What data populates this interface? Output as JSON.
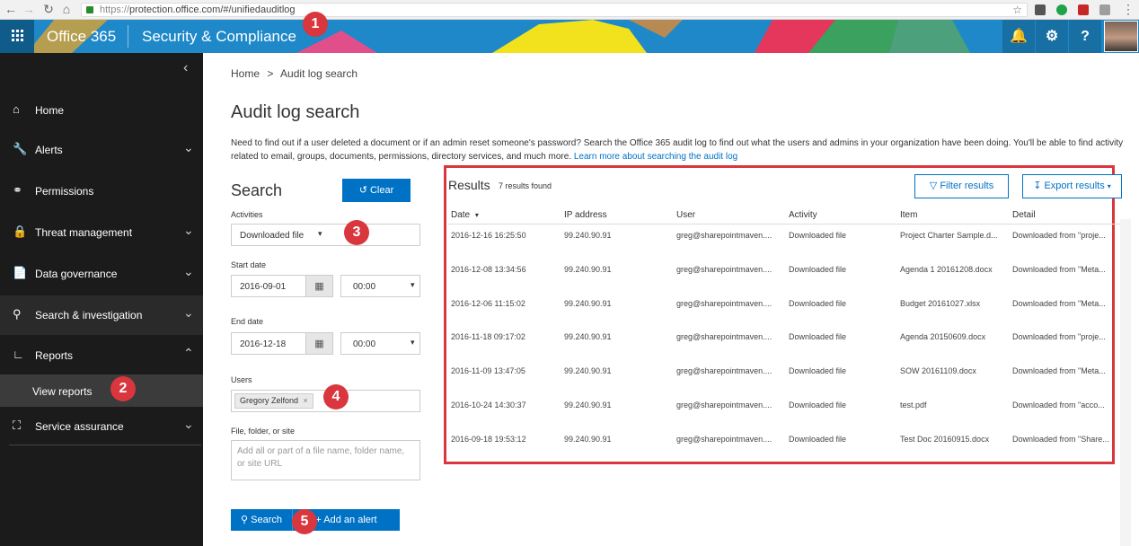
{
  "browser": {
    "url": "https://protection.office.com/#/unifiedauditlog"
  },
  "suite": {
    "app_name": "Office 365",
    "section_name": "Security & Compliance"
  },
  "nav": {
    "items": [
      {
        "label": "Home",
        "icon": "home-icon"
      },
      {
        "label": "Alerts",
        "icon": "wrench-icon"
      },
      {
        "label": "Permissions",
        "icon": "people-icon"
      },
      {
        "label": "Threat management",
        "icon": "lock-icon"
      },
      {
        "label": "Data governance",
        "icon": "document-lock-icon"
      },
      {
        "label": "Search & investigation",
        "icon": "search-icon"
      },
      {
        "label": "Reports",
        "icon": "chart-icon"
      },
      {
        "label": "Service assurance",
        "icon": "service-icon"
      }
    ],
    "subitem": "View reports"
  },
  "breadcrumb": {
    "home": "Home",
    "sep": ">",
    "current": "Audit log search"
  },
  "page": {
    "title": "Audit log search",
    "description": "Need to find out if a user deleted a document or if an admin reset someone's password? Search the Office 365 audit log to find out what the users and admins in your organization have been doing. You'll be able to find activity related to email, groups, documents, permissions, directory services, and much more.",
    "learn_more": "Learn more about searching the audit log"
  },
  "search": {
    "title": "Search",
    "clear_label": "Clear",
    "activities_label": "Activities",
    "activities_value": "Downloaded file",
    "start_label": "Start date",
    "start_date": "2016-09-01",
    "start_time": "00:00",
    "end_label": "End date",
    "end_date": "2016-12-18",
    "end_time": "00:00",
    "users_label": "Users",
    "user_tag": "Gregory Zelfond",
    "file_label": "File, folder, or site",
    "file_placeholder": "Add all or part of a file name, folder name, or site URL",
    "search_label": "Search",
    "alert_label": "Add an alert"
  },
  "results": {
    "title": "Results",
    "count": "7 results found",
    "filter_label": "Filter results",
    "export_label": "Export results",
    "columns": [
      "Date",
      "IP address",
      "User",
      "Activity",
      "Item",
      "Detail"
    ],
    "rows": [
      [
        "2016-12-16 16:25:50",
        "99.240.90.91",
        "greg@sharepointmaven....",
        "Downloaded file",
        "Project Charter Sample.d...",
        "Downloaded from \"proje..."
      ],
      [
        "2016-12-08 13:34:56",
        "99.240.90.91",
        "greg@sharepointmaven....",
        "Downloaded file",
        "Agenda 1 20161208.docx",
        "Downloaded from \"Meta..."
      ],
      [
        "2016-12-06 11:15:02",
        "99.240.90.91",
        "greg@sharepointmaven....",
        "Downloaded file",
        "Budget 20161027.xlsx",
        "Downloaded from \"Meta..."
      ],
      [
        "2016-11-18 09:17:02",
        "99.240.90.91",
        "greg@sharepointmaven....",
        "Downloaded file",
        "Agenda 20150609.docx",
        "Downloaded from \"proje..."
      ],
      [
        "2016-11-09 13:47:05",
        "99.240.90.91",
        "greg@sharepointmaven....",
        "Downloaded file",
        "SOW 20161109.docx",
        "Downloaded from \"Meta..."
      ],
      [
        "2016-10-24 14:30:37",
        "99.240.90.91",
        "greg@sharepointmaven....",
        "Downloaded file",
        "test.pdf",
        "Downloaded from \"acco..."
      ],
      [
        "2016-09-18 19:53:12",
        "99.240.90.91",
        "greg@sharepointmaven....",
        "Downloaded file",
        "Test Doc 20160915.docx",
        "Downloaded from \"Share..."
      ]
    ]
  },
  "annotations": [
    "1",
    "2",
    "3",
    "4",
    "5"
  ],
  "colors": {
    "suite_blue": "#1e88c9",
    "nav_bg": "#1b1b1b",
    "accent": "#0072c6",
    "highlight": "#d9363e"
  }
}
